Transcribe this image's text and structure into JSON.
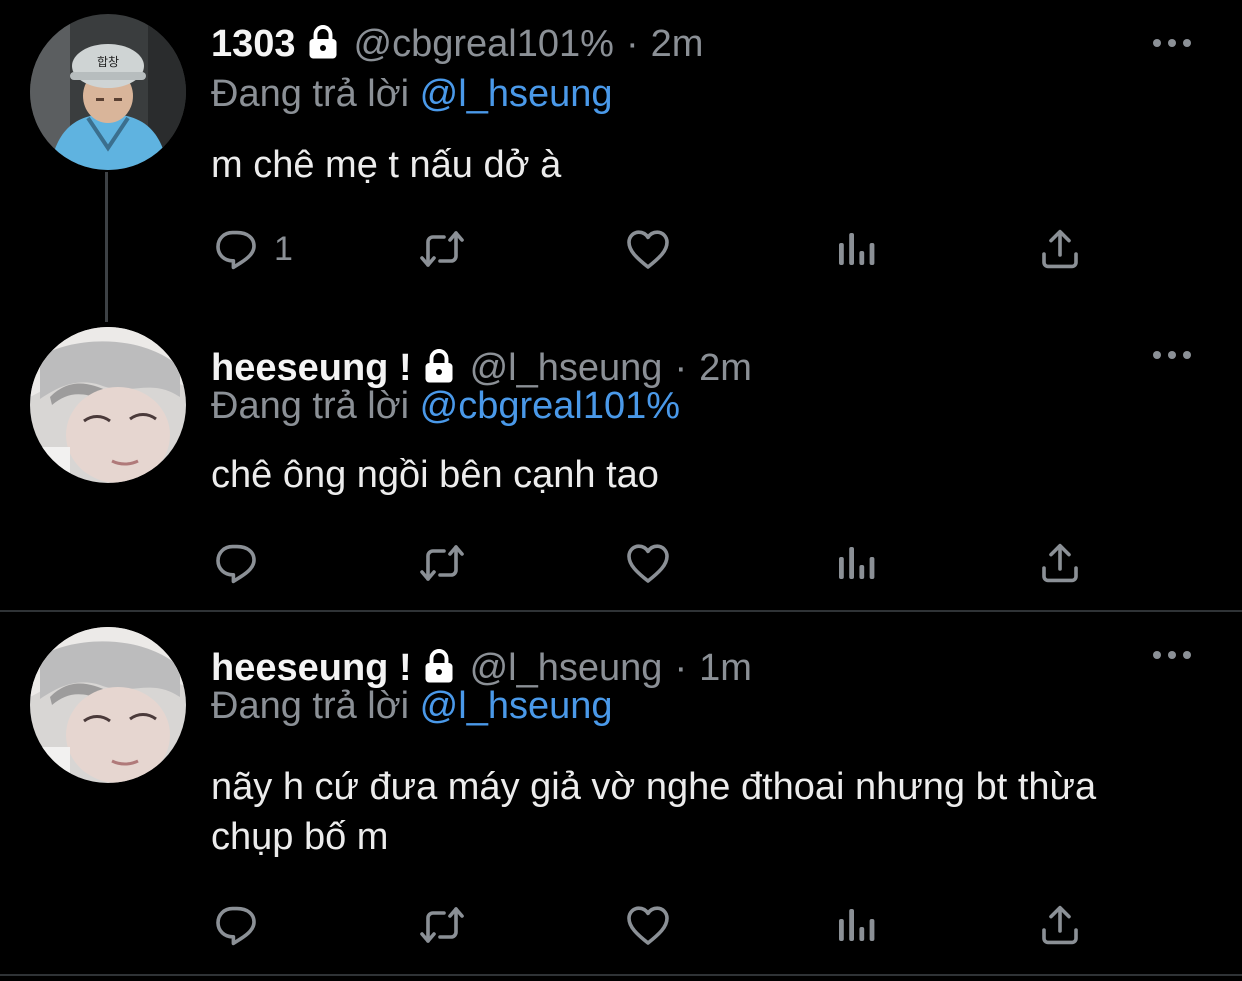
{
  "tweets": [
    {
      "display_name": "1303",
      "handle": "@cbgreal101%",
      "time": "2m",
      "reply_prefix": "Đang trả lời",
      "reply_to": "@l_hseung",
      "text": "m chê mẹ t nấu dở à",
      "reply_count": "1"
    },
    {
      "display_name": "heeseung !",
      "handle": "@l_hseung",
      "time": "2m",
      "reply_prefix": "Đang trả lời",
      "reply_to": "@cbgreal101%",
      "text": "chê ông ngồi bên cạnh tao",
      "reply_count": ""
    },
    {
      "display_name": "heeseung !",
      "handle": "@l_hseung",
      "time": "1m",
      "reply_prefix": "Đang trả lời",
      "reply_to": "@l_hseung",
      "text": "nãy h cứ đưa máy giả vờ nghe đthoai nhưng bt thừa chụp bố m",
      "reply_count": ""
    }
  ],
  "separator": "·",
  "colors": {
    "background": "#000000",
    "accent": "#4a99e9",
    "muted": "#8b9096",
    "divider": "#2f3336"
  }
}
